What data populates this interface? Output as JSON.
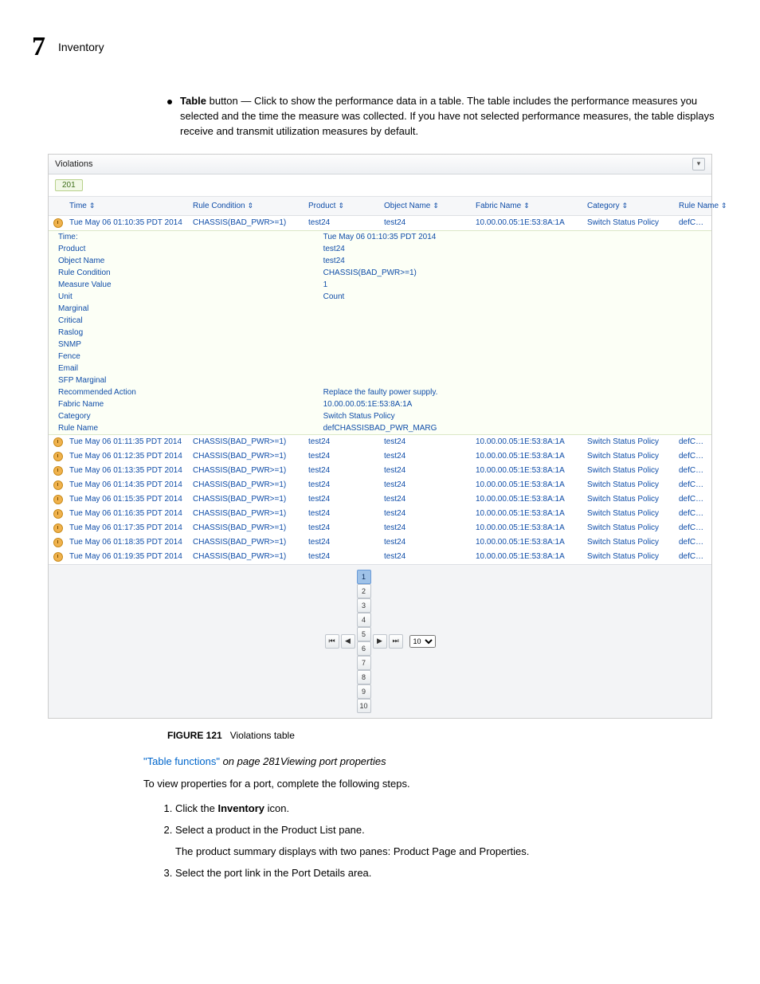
{
  "header": {
    "chapter_number": "7",
    "chapter_title": "Inventory"
  },
  "para1": {
    "lead_bold": "Table",
    "rest": " button — Click to show the performance data in a table. The table includes the performance measures you selected and the time the measure was collected. If you have not selected performance measures, the table displays receive and transmit utilization measures by default."
  },
  "violations_panel": {
    "title": "Violations",
    "count": "201",
    "columns": [
      "Time",
      "Rule Condition",
      "Product",
      "Object Name",
      "Fabric Name",
      "Category",
      "Rule Name"
    ],
    "first_row": {
      "time": "Tue May 06 01:10:35 PDT 2014",
      "rule_condition": "CHASSIS(BAD_PWR>=1)",
      "product": "test24",
      "object_name": "test24",
      "fabric_name": "10.00.00.05:1E:53:8A:1A",
      "category": "Switch Status Policy",
      "rule_name": "defCHASSISBAD_PWR_M"
    },
    "detail_pairs": [
      {
        "label": "Time:",
        "value": "Tue May 06 01:10:35 PDT 2014"
      },
      {
        "label": "Product",
        "value": "test24"
      },
      {
        "label": "Object Name",
        "value": "test24"
      },
      {
        "label": "Rule Condition",
        "value": "CHASSIS(BAD_PWR>=1)"
      },
      {
        "label": "Measure Value",
        "value": "1"
      },
      {
        "label": "Unit",
        "value": "Count"
      },
      {
        "label": "Marginal",
        "value": ""
      },
      {
        "label": "Critical",
        "value": ""
      },
      {
        "label": "Raslog",
        "value": ""
      },
      {
        "label": "SNMP",
        "value": ""
      },
      {
        "label": "Fence",
        "value": ""
      },
      {
        "label": "Email",
        "value": ""
      },
      {
        "label": "SFP Marginal",
        "value": ""
      },
      {
        "label": "Recommended Action",
        "value": "Replace the faulty power supply."
      },
      {
        "label": "Fabric Name",
        "value": "10.00.00.05:1E:53:8A:1A"
      },
      {
        "label": "Category",
        "value": "Switch Status Policy"
      },
      {
        "label": "Rule Name",
        "value": "defCHASSISBAD_PWR_MARG"
      }
    ],
    "rows": [
      {
        "time": "Tue May 06 01:11:35 PDT 2014",
        "rc": "CHASSIS(BAD_PWR>=1)",
        "p": "test24",
        "o": "test24",
        "f": "10.00.00.05:1E:53:8A:1A",
        "c": "Switch Status Policy",
        "r": "defCHASSISBAD_PWR_M"
      },
      {
        "time": "Tue May 06 01:12:35 PDT 2014",
        "rc": "CHASSIS(BAD_PWR>=1)",
        "p": "test24",
        "o": "test24",
        "f": "10.00.00.05:1E:53:8A:1A",
        "c": "Switch Status Policy",
        "r": "defCHASSISBAD_PWR_M"
      },
      {
        "time": "Tue May 06 01:13:35 PDT 2014",
        "rc": "CHASSIS(BAD_PWR>=1)",
        "p": "test24",
        "o": "test24",
        "f": "10.00.00.05:1E:53:8A:1A",
        "c": "Switch Status Policy",
        "r": "defCHASSISBAD_PWR_M"
      },
      {
        "time": "Tue May 06 01:14:35 PDT 2014",
        "rc": "CHASSIS(BAD_PWR>=1)",
        "p": "test24",
        "o": "test24",
        "f": "10.00.00.05:1E:53:8A:1A",
        "c": "Switch Status Policy",
        "r": "defCHASSISBAD_PWR_M"
      },
      {
        "time": "Tue May 06 01:15:35 PDT 2014",
        "rc": "CHASSIS(BAD_PWR>=1)",
        "p": "test24",
        "o": "test24",
        "f": "10.00.00.05:1E:53:8A:1A",
        "c": "Switch Status Policy",
        "r": "defCHASSISBAD_PWR_M"
      },
      {
        "time": "Tue May 06 01:16:35 PDT 2014",
        "rc": "CHASSIS(BAD_PWR>=1)",
        "p": "test24",
        "o": "test24",
        "f": "10.00.00.05:1E:53:8A:1A",
        "c": "Switch Status Policy",
        "r": "defCHASSISBAD_PWR_M"
      },
      {
        "time": "Tue May 06 01:17:35 PDT 2014",
        "rc": "CHASSIS(BAD_PWR>=1)",
        "p": "test24",
        "o": "test24",
        "f": "10.00.00.05:1E:53:8A:1A",
        "c": "Switch Status Policy",
        "r": "defCHASSISBAD_PWR_M"
      },
      {
        "time": "Tue May 06 01:18:35 PDT 2014",
        "rc": "CHASSIS(BAD_PWR>=1)",
        "p": "test24",
        "o": "test24",
        "f": "10.00.00.05:1E:53:8A:1A",
        "c": "Switch Status Policy",
        "r": "defCHASSISBAD_PWR_M"
      },
      {
        "time": "Tue May 06 01:19:35 PDT 2014",
        "rc": "CHASSIS(BAD_PWR>=1)",
        "p": "test24",
        "o": "test24",
        "f": "10.00.00.05:1E:53:8A:1A",
        "c": "Switch Status Policy",
        "r": "defCHASSISBAD_PWR_M"
      }
    ],
    "pager": {
      "first": "⏮",
      "prev": "◀",
      "next": "▶",
      "last": "⏭",
      "pages": [
        "1",
        "2",
        "3",
        "4",
        "5",
        "6",
        "7",
        "8",
        "9",
        "10"
      ],
      "page_size_options": [
        "10"
      ],
      "page_size_selected": "10"
    }
  },
  "figure": {
    "label": "FIGURE 121",
    "caption": "Violations table"
  },
  "link_line": {
    "link_text": "\"Table functions\"",
    "italic_text": " on page 281Viewing port properties"
  },
  "intro_para": "To view properties for a port, complete the following steps.",
  "steps": [
    {
      "pre": "Click the ",
      "bold": "Inventory",
      "post": " icon."
    },
    {
      "text": "Select a product in the Product List pane.",
      "sub": "The product summary displays with two panes: Product Page and Properties."
    },
    {
      "text": "Select the port link in the Port Details area."
    }
  ]
}
